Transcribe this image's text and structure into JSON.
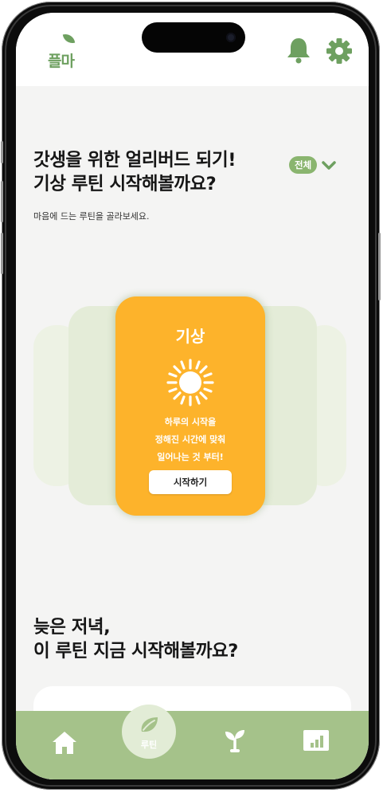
{
  "app": {
    "logo_text": "플마",
    "icons": [
      "bell-icon",
      "gear-icon"
    ]
  },
  "headline": {
    "line1": "갓생을 위한 얼리버드 되기!",
    "line2": "기상 루틴 시작해볼까요?"
  },
  "filter": {
    "label": "전체"
  },
  "subtitle": "마음에 드는 루틴을 골라보세요.",
  "routine_card": {
    "title": "기상",
    "icon": "sun-icon",
    "desc_line1": "하루의 시작을",
    "desc_line2": "정해진 시간에 맞춰",
    "desc_line3": "일어나는 것 부터!",
    "button_label": "시작하기"
  },
  "headline2": {
    "line1": "늦은 저녁,",
    "line2": "이 루틴 지금 시작해볼까요?"
  },
  "bottom_nav": {
    "items": [
      {
        "icon": "home-icon"
      },
      {
        "icon": "leaf-icon",
        "label": "루틴"
      },
      {
        "icon": "sprout-icon"
      },
      {
        "icon": "chart-icon"
      }
    ]
  },
  "colors": {
    "brand_green": "#6ea060",
    "card_orange": "#fdb32b",
    "nav_green": "#a5c28a",
    "pill_green": "#8ab56f"
  }
}
